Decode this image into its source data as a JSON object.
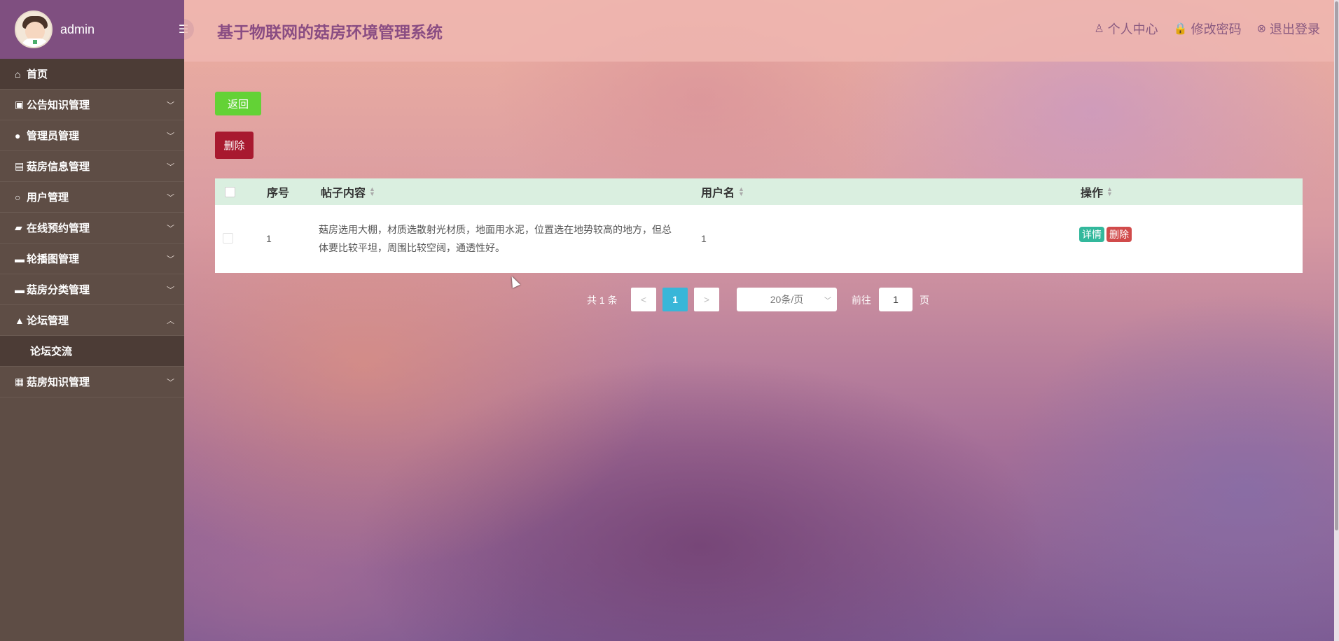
{
  "sidebar": {
    "username": "admin",
    "menu": [
      {
        "label": "首页",
        "icon": "home-icon",
        "glyph": "⌂"
      },
      {
        "label": "公告知识管理",
        "icon": "briefcase-icon",
        "glyph": "▣"
      },
      {
        "label": "管理员管理",
        "icon": "user-icon",
        "glyph": "●"
      },
      {
        "label": "菇房信息管理",
        "icon": "print-icon",
        "glyph": "▤"
      },
      {
        "label": "用户管理",
        "icon": "user-outline-icon",
        "glyph": "○"
      },
      {
        "label": "在线预约管理",
        "icon": "folder-icon",
        "glyph": "▰"
      },
      {
        "label": "轮播图管理",
        "icon": "card-icon",
        "glyph": "▬"
      },
      {
        "label": "菇房分类管理",
        "icon": "card-icon",
        "glyph": "▬"
      },
      {
        "label": "论坛管理",
        "icon": "bank-icon",
        "glyph": "▲"
      },
      {
        "label": "菇房知识管理",
        "icon": "grid-icon",
        "glyph": "▦"
      }
    ],
    "submenu": {
      "label": "论坛交流"
    }
  },
  "header": {
    "title": "基于物联网的菇房环境管理系统",
    "links": [
      {
        "label": "个人中心",
        "icon": "user-outline-icon",
        "glyph": "♙"
      },
      {
        "label": "修改密码",
        "icon": "lock-icon",
        "glyph": "🔒"
      },
      {
        "label": "退出登录",
        "icon": "close-circle-icon",
        "glyph": "⊗"
      }
    ]
  },
  "actions": {
    "back": "返回",
    "delete": "删除"
  },
  "table": {
    "headers": {
      "index": "序号",
      "content": "帖子内容",
      "username": "用户名",
      "actions": "操作"
    },
    "rows": [
      {
        "index": "1",
        "content": "菇房选用大棚，材质选散射光材质，地面用水泥，位置选在地势较高的地方，但总体要比较平坦，周围比较空阔，通透性好。",
        "username": "1",
        "detail": "详情",
        "delete": "删除"
      }
    ]
  },
  "pagination": {
    "total": "共 1 条",
    "prev": "<",
    "current": "1",
    "next": ">",
    "page_size": "20条/页",
    "goto": "前往",
    "goto_value": "1",
    "unit": "页"
  },
  "colors": {
    "sidebar": "#5e4d45",
    "sidebar_head": "#7f4f80",
    "back": "#63d236",
    "delete": "#a8192f",
    "table_header": "#daefe0",
    "page_active": "#38b6d8"
  }
}
